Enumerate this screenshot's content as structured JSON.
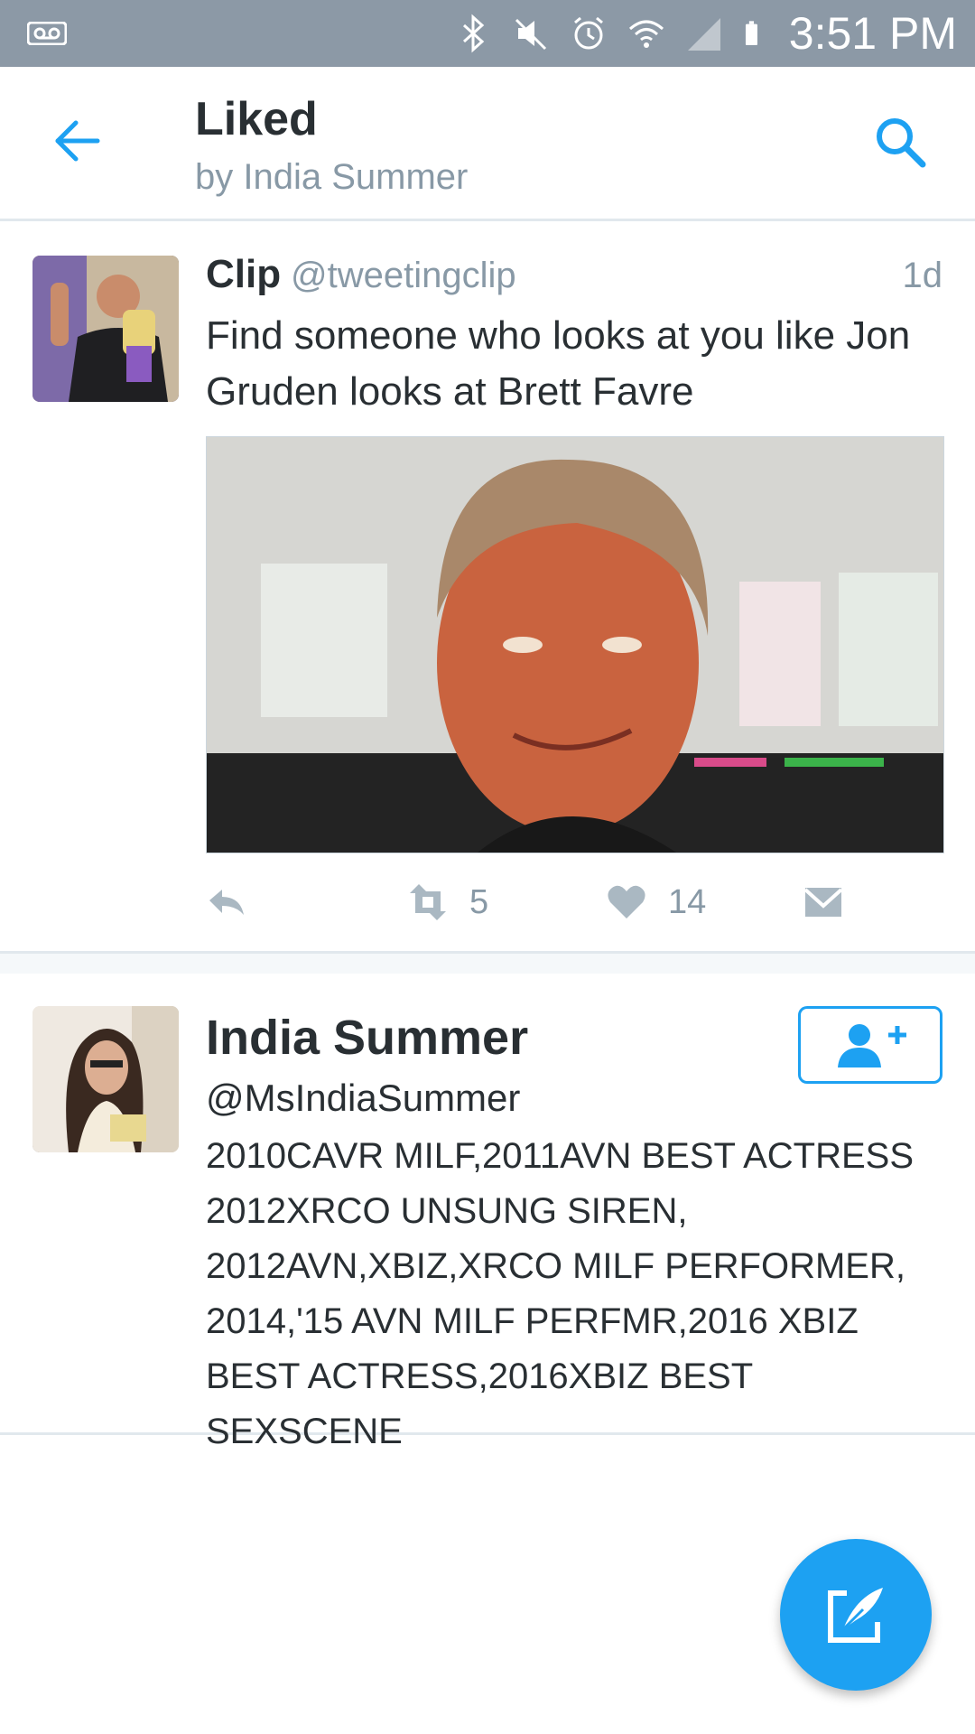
{
  "status_bar": {
    "time": "3:51 PM",
    "icons": [
      "voicemail-icon",
      "bluetooth-icon",
      "mute-icon",
      "alarm-icon",
      "wifi-icon",
      "signal-icon",
      "battery-icon"
    ]
  },
  "header": {
    "title": "Liked",
    "subtitle": "by India Summer",
    "back_icon": "arrow-left-icon",
    "search_icon": "search-icon"
  },
  "tweet": {
    "author_name": "Clip",
    "author_handle": "@tweetingclip",
    "timestamp": "1d",
    "text": "Find someone who looks at you like Jon Gruden looks at Brett Favre",
    "media_alt": "photo",
    "retweet_count": "5",
    "like_count": "14"
  },
  "user_card": {
    "name": "India Summer",
    "handle": "@MsIndiaSummer",
    "bio": "2010CAVR MILF,2011AVN BEST ACTRESS\n2012XRCO UNSUNG SIREN,\n2012AVN,XBIZ,XRCO MILF PERFORMER,\n2014,'15 AVN MILF PERFMR,2016 XBIZ\nBEST ACTRESS,2016XBIZ BEST SEXSCENE"
  },
  "colors": {
    "accent": "#1da1f2",
    "status_bar": "#8c99a6",
    "secondary_text": "#8899a6",
    "primary_text": "#292f33"
  }
}
